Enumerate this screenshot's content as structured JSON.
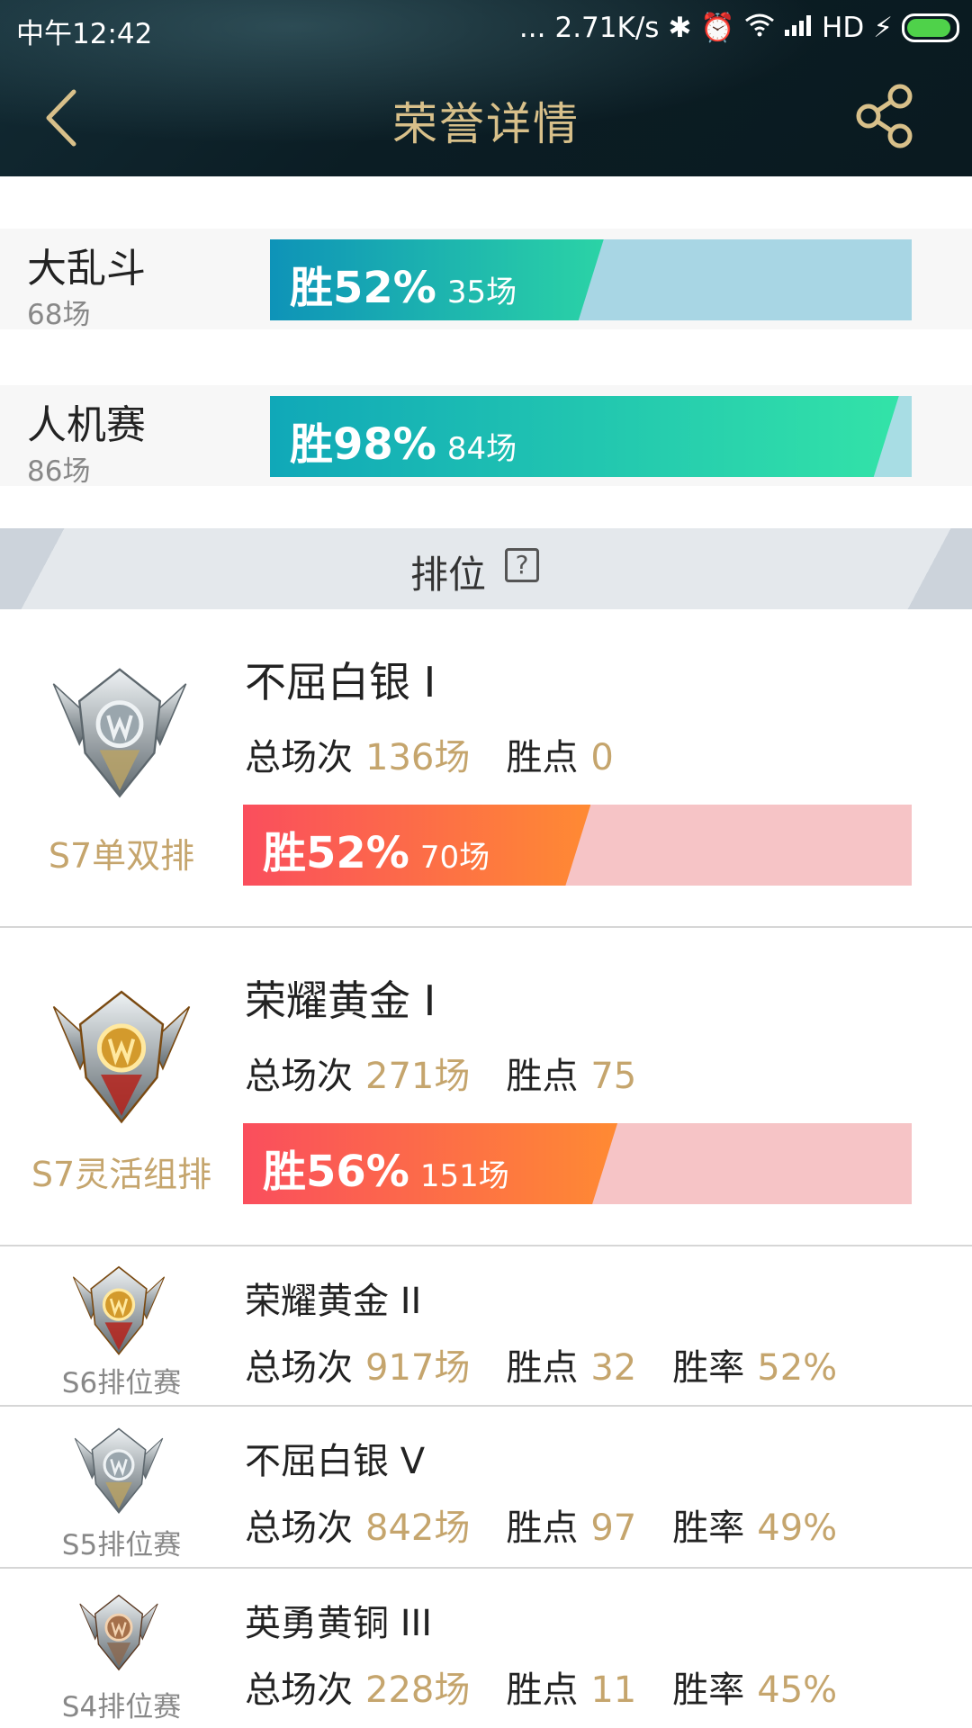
{
  "status_bar": {
    "time": "中午12:42",
    "dots": "...",
    "speed": "2.71K/s",
    "network": "HD",
    "battery_color": "#4fd24a"
  },
  "nav": {
    "title": "荣誉详情",
    "back_icon": "chevron-left-icon",
    "share_icon": "share-icon",
    "accent": "#d8c08a"
  },
  "modes": [
    {
      "name": "大乱斗",
      "count": "68场",
      "win_label": "胜52%",
      "wins": "35场",
      "win_rate": 52,
      "fill": "linear-gradient(90deg,#0e93b8,#2bd3a6)",
      "track": "#a8d6e4"
    },
    {
      "name": "人机赛",
      "count": "86场",
      "win_label": "胜98%",
      "wins": "84场",
      "win_rate": 98,
      "fill": "linear-gradient(90deg,#10a8b8,#33e3a8)",
      "track": "#a8dde4"
    }
  ],
  "ranked_section": {
    "title": "排位",
    "help": "?"
  },
  "ranks": [
    {
      "season": "S7单双排",
      "rank": "不屈白银 I",
      "total_label": "总场次",
      "total": "136场",
      "lp_label": "胜点",
      "lp": "0",
      "win_label": "胜52%",
      "wins": "70场",
      "win_rate": 52,
      "tier": "silver"
    },
    {
      "season": "S7灵活组排",
      "rank": "荣耀黄金 I",
      "total_label": "总场次",
      "total": "271场",
      "lp_label": "胜点",
      "lp": "75",
      "win_label": "胜56%",
      "wins": "151场",
      "win_rate": 56,
      "tier": "gold"
    },
    {
      "season": "S6排位赛",
      "rank": "荣耀黄金 II",
      "total_label": "总场次",
      "total": "917场",
      "lp_label": "胜点",
      "lp": "32",
      "rate_label": "胜率",
      "rate": "52%",
      "tier": "gold"
    },
    {
      "season": "S5排位赛",
      "rank": "不屈白银 V",
      "total_label": "总场次",
      "total": "842场",
      "lp_label": "胜点",
      "lp": "97",
      "rate_label": "胜率",
      "rate": "49%",
      "tier": "silver"
    },
    {
      "season": "S4排位赛",
      "rank": "英勇黄铜 III",
      "total_label": "总场次",
      "total": "228场",
      "lp_label": "胜点",
      "lp": "11",
      "rate_label": "胜率",
      "rate": "45%",
      "tier": "bronze"
    }
  ]
}
